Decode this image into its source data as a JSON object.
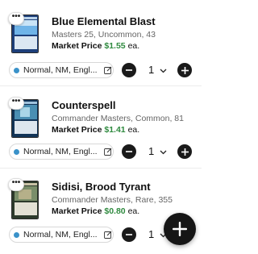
{
  "items": [
    {
      "name": "Blue Elemental Blast",
      "meta": "Masters 25, Uncommon, 43",
      "price_label": "Market Price",
      "price": "$1.55",
      "price_suffix": "ea.",
      "condition": "Normal, NM, Engl...",
      "quantity": "1",
      "more_label": "•••"
    },
    {
      "name": "Counterspell",
      "meta": "Commander Masters, Common, 81",
      "price_label": "Market Price",
      "price": "$1.41",
      "price_suffix": "ea.",
      "condition": "Normal, NM, Engl...",
      "quantity": "1",
      "more_label": "•••"
    },
    {
      "name": "Sidisi, Brood Tyrant",
      "meta": "Commander Masters, Rare, 355",
      "price_label": "Market Price",
      "price": "$0.80",
      "price_suffix": "ea.",
      "condition": "Normal, NM, Engl...",
      "quantity": "1",
      "more_label": "•••"
    }
  ],
  "colors": {
    "price_green": "#2f8a3f",
    "condition_dot": "#3a92c9",
    "button_dark": "#1a1a1a"
  },
  "icons": {
    "more": "more-options-icon",
    "edit": "edit-icon",
    "minus": "minus-icon",
    "plus": "plus-icon",
    "chevron": "chevron-down-icon",
    "fab": "add-fab-icon"
  }
}
